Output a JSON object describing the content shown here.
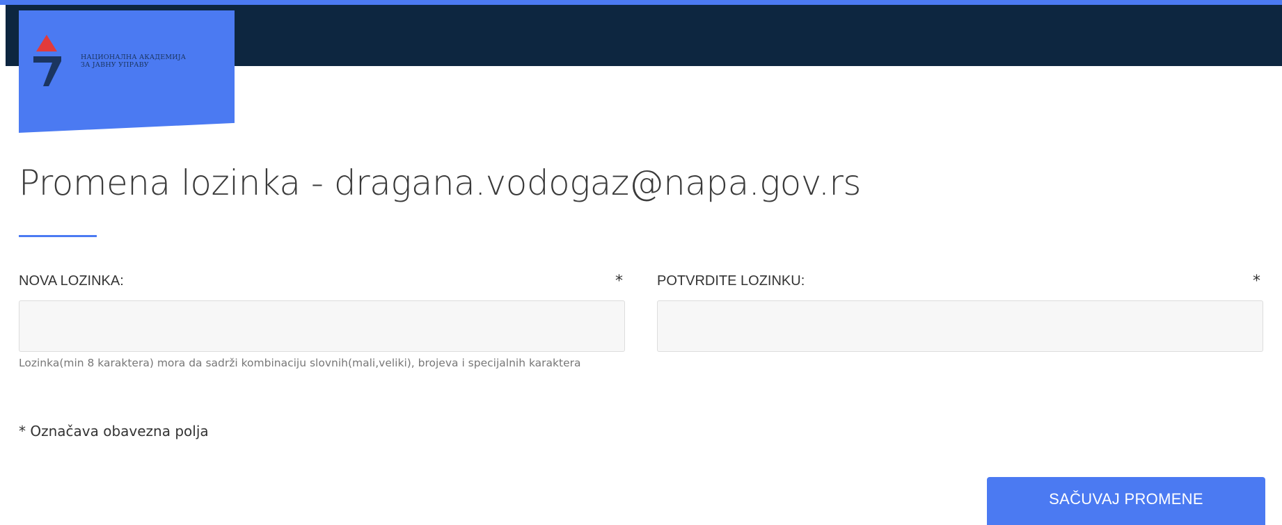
{
  "header": {
    "logo": {
      "line1": "НАЦИОНАЛНА АКАДЕМИЈА",
      "line2": "ЗА ЈАВНУ УПРАВУ",
      "icon": "napa-logo-icon",
      "mark_colors": {
        "top": "#e23b3b",
        "bottom": "#1b3560"
      }
    },
    "bar_color": "#0d2640",
    "accent_color": "#4b7af2"
  },
  "page": {
    "title": "Promena lozinka - dragana.vodogaz@napa.gov.rs"
  },
  "form": {
    "new_password": {
      "label": "NOVA LOZINKA:",
      "required_mark": "*",
      "value": "",
      "hint": "Lozinka(min 8 karaktera) mora da sadrži kombinaciju slovnih(mali,veliki), brojeva i specijalnih karaktera"
    },
    "confirm_password": {
      "label": "POTVRDITE LOZINKU:",
      "required_mark": "*",
      "value": ""
    },
    "required_note": "* Označava obavezna polja",
    "save_label": "SAČUVAJ PROMENE"
  }
}
